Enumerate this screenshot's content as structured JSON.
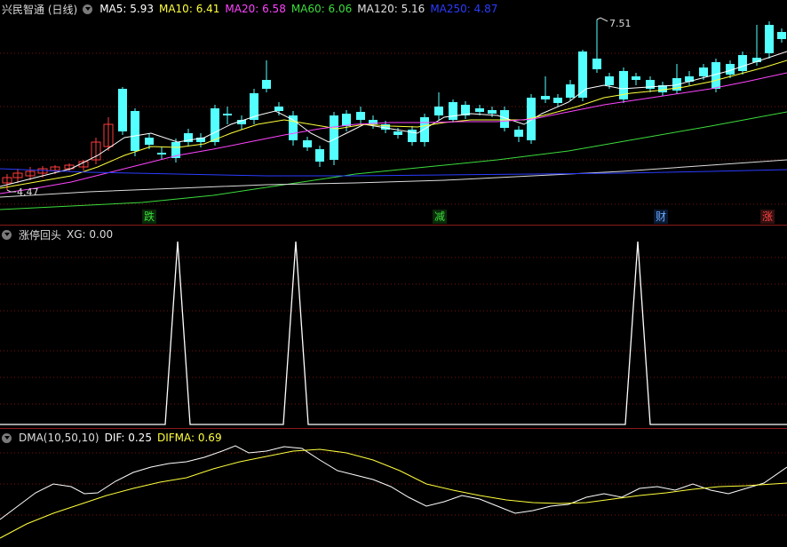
{
  "main_panel": {
    "title": "兴民智通 (日线)",
    "indicators": [
      {
        "label": "MA5:",
        "value": "5.93",
        "color": "#ffffff"
      },
      {
        "label": "MA10:",
        "value": "6.41",
        "color": "#ffff3c"
      },
      {
        "label": "MA20:",
        "value": "6.58",
        "color": "#ff44ff"
      },
      {
        "label": "MA60:",
        "value": "6.06",
        "color": "#3cdc3c"
      },
      {
        "label": "MA120:",
        "value": "5.16",
        "color": "#e0e0e0"
      },
      {
        "label": "MA250:",
        "value": "4.87",
        "color": "#2a3cff"
      }
    ],
    "high_label": "7.51",
    "low_label": "4.47",
    "tags": [
      {
        "text": "跌",
        "color": "#3cdc3c"
      },
      {
        "text": "减",
        "color": "#3cdc3c"
      },
      {
        "text": "财",
        "color": "#6aa8ff"
      },
      {
        "text": "涨",
        "color": "#ff4040"
      }
    ]
  },
  "xg_panel": {
    "title": "涨停回头",
    "label": "XG:",
    "value": "0.00",
    "spikes": [
      3,
      4,
      10
    ]
  },
  "dma_panel": {
    "title": "DMA(10,50,10)",
    "dif_label": "DIF:",
    "dif_value": "0.25",
    "difma_label": "DIFMA:",
    "difma_value": "0.69"
  },
  "colors": {
    "up": "#ff3c3c",
    "down": "#54ffff",
    "grid": "#7a1010",
    "separator": "#8b1a1a"
  }
}
